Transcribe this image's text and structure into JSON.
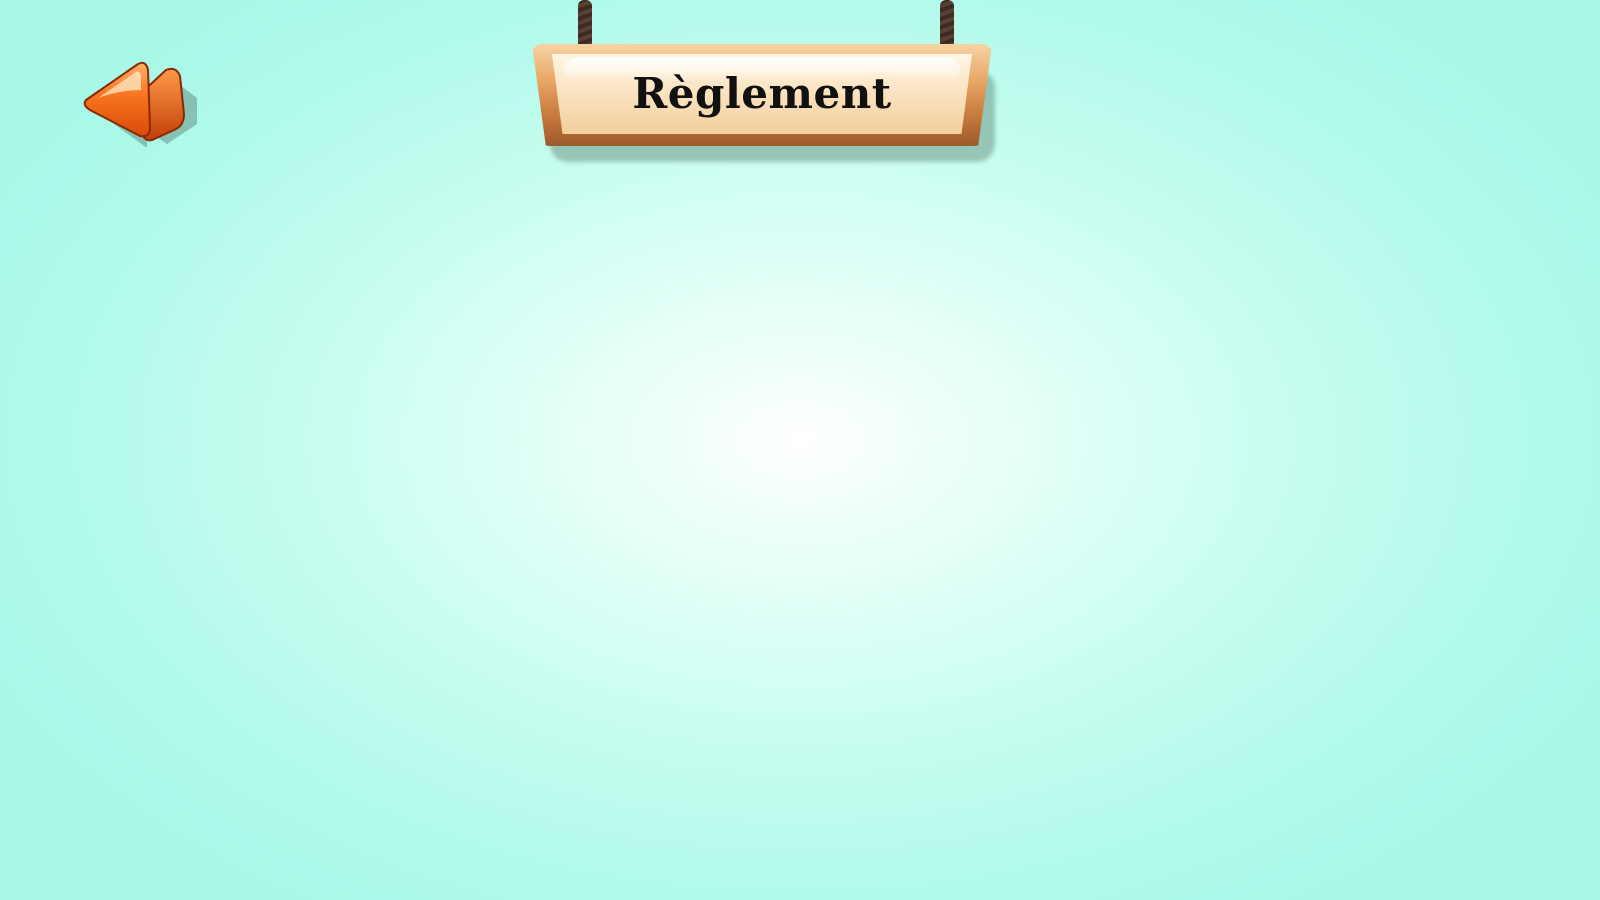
{
  "screen": {
    "title": "Règlement",
    "background_color": "#a8f8e8",
    "accent_color": "#f26b1d"
  },
  "back_button": {
    "icon": "back-arrow-icon"
  }
}
